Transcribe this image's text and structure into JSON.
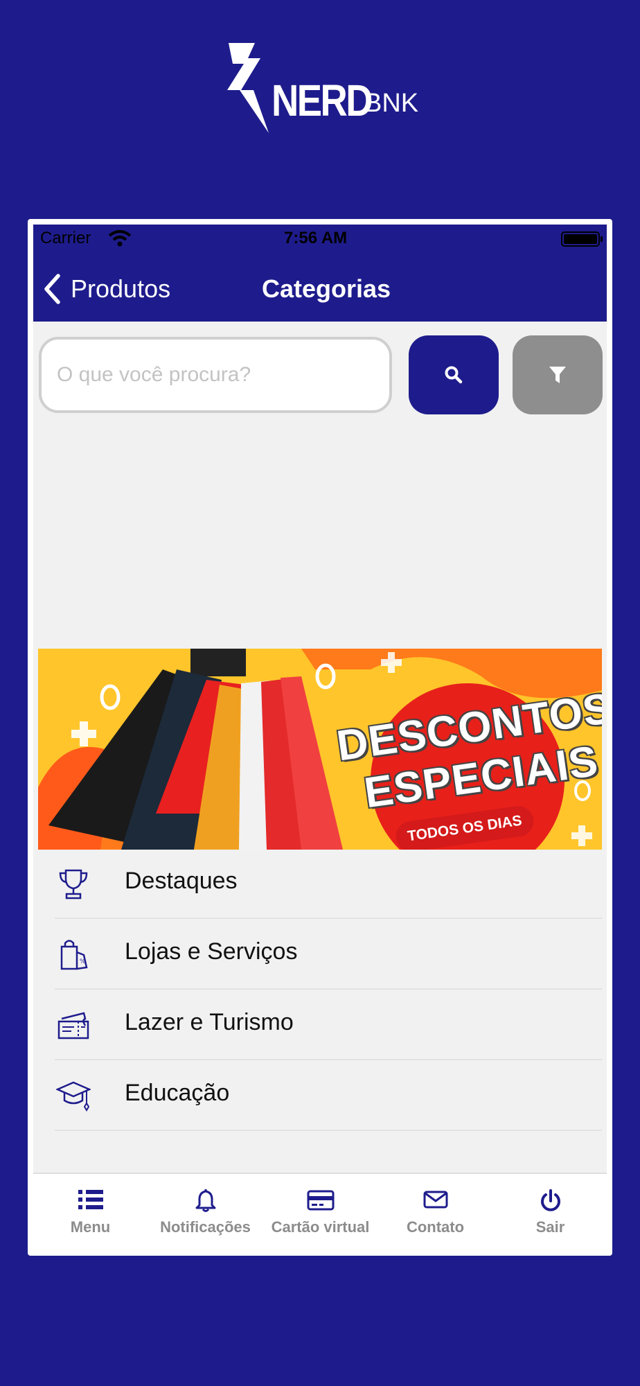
{
  "brand": {
    "name_bold": "NERD",
    "name_light": "BNK",
    "background_color": "#1e1c8c"
  },
  "status_bar": {
    "carrier": "Carrier",
    "time": "7:56 AM"
  },
  "nav": {
    "back_label": "Produtos",
    "title": "Categorias"
  },
  "search": {
    "placeholder": "O que você procura?",
    "value": ""
  },
  "banner": {
    "line1": "DESCONTOS",
    "line2": "ESPECIAIS",
    "tag": "TODOS OS DIAS"
  },
  "categories": [
    {
      "label": "Destaques",
      "icon": "trophy-icon"
    },
    {
      "label": "Lojas e Serviços",
      "icon": "shopping-bag-icon"
    },
    {
      "label": "Lazer e Turismo",
      "icon": "tickets-icon"
    },
    {
      "label": "Educação",
      "icon": "graduation-cap-icon"
    }
  ],
  "tabbar": [
    {
      "label": "Menu",
      "icon": "list-icon"
    },
    {
      "label": "Notificações",
      "icon": "bell-icon"
    },
    {
      "label": "Cartão virtual",
      "icon": "credit-card-icon"
    },
    {
      "label": "Contato",
      "icon": "envelope-icon"
    },
    {
      "label": "Sair",
      "icon": "power-icon"
    }
  ],
  "colors": {
    "accent": "#1e1c8c",
    "filter_button": "#8e8e8e",
    "tab_label": "#8c8c8c"
  }
}
